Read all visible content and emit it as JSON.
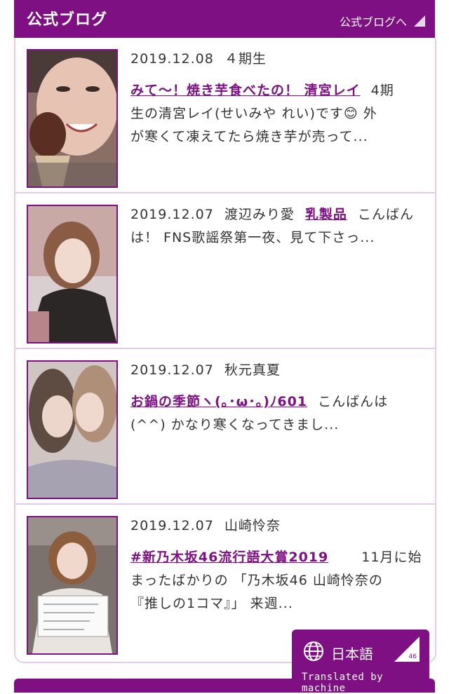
{
  "header": {
    "title": "公式ブログ",
    "link_label": "公式ブログへ"
  },
  "entries": [
    {
      "date": "2019.12.08",
      "author": "４期生",
      "title": "みて〜！焼き芋食べたの！ 清宮レイ",
      "excerpt_lines": [
        "4期",
        "生の清宮レイ(せいみや れい)です😊 外",
        "が寒くて凍えてたら焼き芋が売って..."
      ]
    },
    {
      "date": "2019.12.07",
      "author": "渡辺みり愛",
      "title": "乳製品",
      "excerpt_lines": [
        "こんばん",
        "は！ FNS歌謡祭第一夜、見て下さっ..."
      ]
    },
    {
      "date": "2019.12.07",
      "author": "秋元真夏",
      "title": "お鍋の季節ヽ(｡･ω･｡)ﾉ601",
      "excerpt_lines": [
        "こんばんは",
        "(^^) かなり寒くなってきまし..."
      ]
    },
    {
      "date": "2019.12.07",
      "author": "山崎怜奈",
      "title": "#新乃木坂46流行語大賞2019",
      "excerpt_lines": [
        "11月に始",
        "まったばかりの 「乃木坂46 山崎怜奈の",
        "『推しの1コマ』」 来週..."
      ]
    }
  ],
  "language_widget": {
    "label": "日本語",
    "corner_text": "46",
    "translated_label": "Translated by machine",
    "icon": "globe-icon"
  },
  "colors": {
    "brand": "#7e1083",
    "border": "#e5cde8"
  }
}
